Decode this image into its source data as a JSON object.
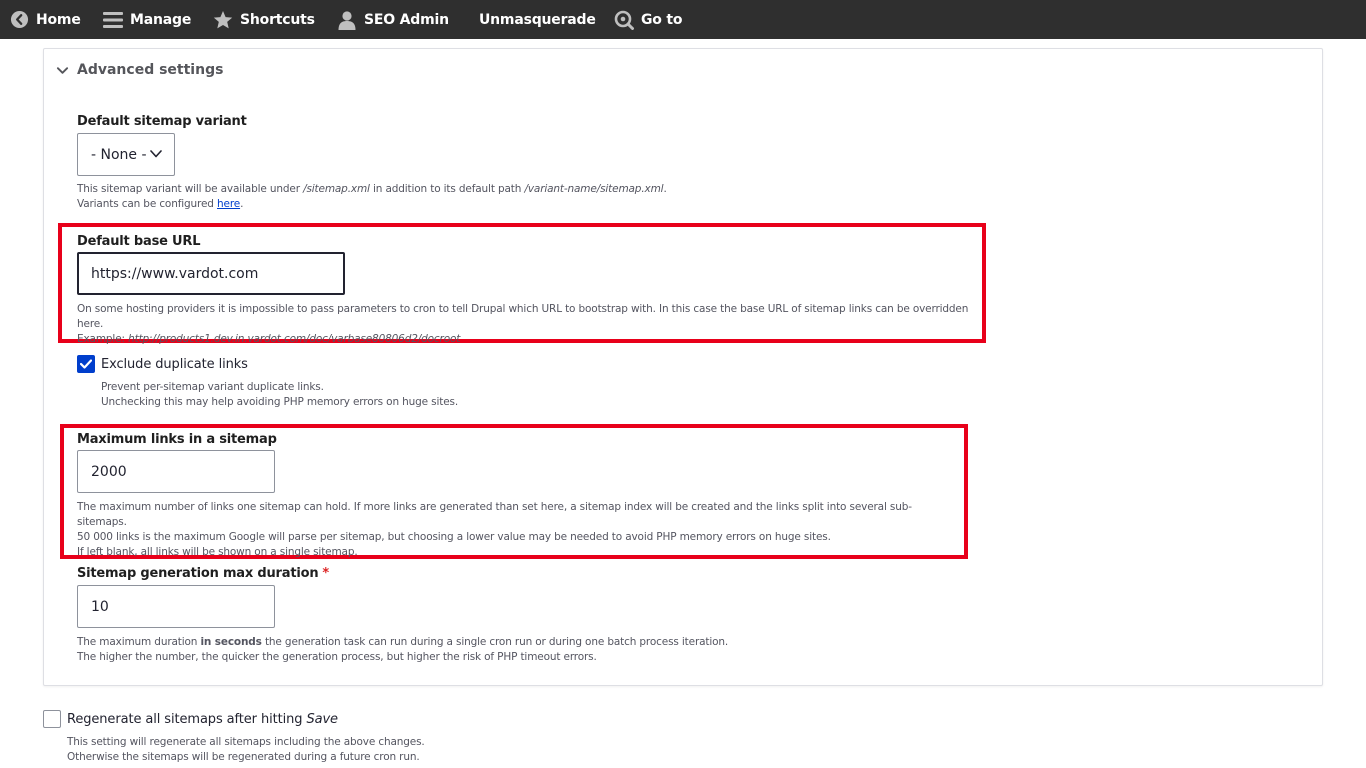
{
  "toolbar": {
    "items": [
      {
        "label": "Home",
        "icon": "chevron-left-circle-icon"
      },
      {
        "label": "Manage",
        "icon": "hamburger-menu-icon"
      },
      {
        "label": "Shortcuts",
        "icon": "star-icon"
      },
      {
        "label": "SEO Admin",
        "icon": "user-icon"
      },
      {
        "label": "Unmasquerade",
        "icon": ""
      },
      {
        "label": "Go to",
        "icon": "search-icon"
      }
    ]
  },
  "advanced": {
    "summary": "Advanced settings",
    "default_variant": {
      "label": "Default sitemap variant",
      "value": "- None -",
      "desc_1_pre": "This sitemap variant will be available under ",
      "desc_1_path": "/sitemap.xml",
      "desc_1_mid": " in addition to its default path ",
      "desc_1_path2": "/variant-name/sitemap.xml",
      "desc_1_post": ".",
      "desc_2_pre": "Variants can be configured ",
      "desc_2_link": "here",
      "desc_2_post": "."
    },
    "base_url": {
      "label": "Default base URL",
      "value": "https://www.vardot.com",
      "desc_1": "On some hosting providers it is impossible to pass parameters to cron to tell Drupal which URL to bootstrap with. In this case the base URL of sitemap links can be overridden here.",
      "desc_2_pre": "Example: ",
      "desc_2_example": "http://products1.dev.in.vardot.com/doc/varbase80806d2/docroot"
    },
    "exclude_duplicates": {
      "label": "Exclude duplicate links",
      "checked": true,
      "desc_1": "Prevent per-sitemap variant duplicate links.",
      "desc_2": "Unchecking this may help avoiding PHP memory errors on huge sites."
    },
    "max_links": {
      "label": "Maximum links in a sitemap",
      "value": "2000",
      "desc_1": "The maximum number of links one sitemap can hold. If more links are generated than set here, a sitemap index will be created and the links split into several sub-sitemaps.",
      "desc_2": "50 000 links is the maximum Google will parse per sitemap, but choosing a lower value may be needed to avoid PHP memory errors on huge sites.",
      "desc_3": "If left blank, all links will be shown on a single sitemap."
    },
    "max_duration": {
      "label": "Sitemap generation max duration",
      "required_mark": "*",
      "value": "10",
      "desc_1_pre": "The maximum duration ",
      "desc_1_bold": "in seconds",
      "desc_1_post": " the generation task can run during a single cron run or during one batch process iteration.",
      "desc_2": "The higher the number, the quicker the generation process, but higher the risk of PHP timeout errors."
    }
  },
  "regenerate": {
    "label_pre": "Regenerate all sitemaps after hitting ",
    "label_em": "Save",
    "checked": false,
    "desc_1": "This setting will regenerate all sitemaps including the above changes.",
    "desc_2": "Otherwise the sitemaps will be regenerated during a future cron run."
  },
  "colors": {
    "toolbar_bg": "#2f2f2f",
    "highlight": "#e8001a",
    "checkbox_accent": "#003ecc",
    "required": "#dc2323"
  }
}
